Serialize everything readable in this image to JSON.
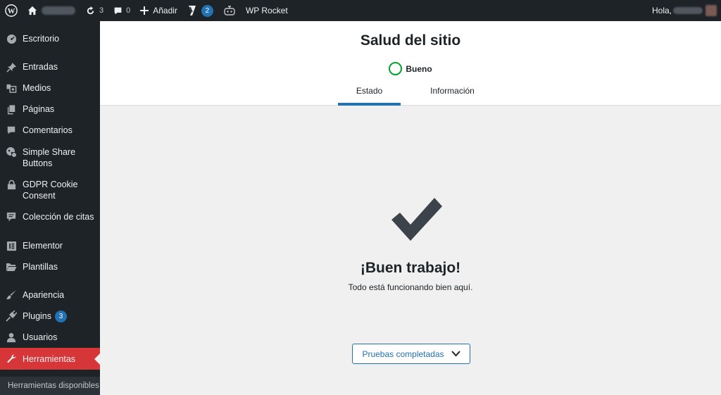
{
  "adminbar": {
    "updates_count": "3",
    "comments_count": "0",
    "add_new_label": "Añadir",
    "yoast_badge": "2",
    "wp_rocket_label": "WP Rocket",
    "greeting": "Hola,"
  },
  "sidebar": {
    "items": [
      {
        "label": "Escritorio",
        "icon": "dashboard-icon"
      },
      {
        "label": "Entradas",
        "icon": "pin-icon"
      },
      {
        "label": "Medios",
        "icon": "media-icon"
      },
      {
        "label": "Páginas",
        "icon": "pages-icon"
      },
      {
        "label": "Comentarios",
        "icon": "comment-icon"
      },
      {
        "label": "Simple Share Buttons",
        "icon": "share-icon"
      },
      {
        "label": "GDPR Cookie Consent",
        "icon": "lock-icon"
      },
      {
        "label": "Colección de citas",
        "icon": "quote-icon"
      },
      {
        "label": "Elementor",
        "icon": "elementor-icon"
      },
      {
        "label": "Plantillas",
        "icon": "folder-icon"
      },
      {
        "label": "Apariencia",
        "icon": "brush-icon"
      },
      {
        "label": "Plugins",
        "icon": "plugin-icon",
        "badge": "3"
      },
      {
        "label": "Usuarios",
        "icon": "user-icon"
      },
      {
        "label": "Herramientas",
        "icon": "wrench-icon",
        "active": true
      }
    ],
    "submenu_label": "Herramientas disponibles"
  },
  "header": {
    "title": "Salud del sitio",
    "status": "Bueno",
    "tabs": [
      {
        "label": "Estado",
        "active": true
      },
      {
        "label": "Información",
        "active": false
      }
    ]
  },
  "main": {
    "heading": "¡Buen trabajo!",
    "message": "Todo está funcionando bien aquí.",
    "tests_button": "Pruebas completadas"
  },
  "colors": {
    "adminbar_bg": "#1d2327",
    "active_menu": "#d63638",
    "accent": "#2271b1",
    "good_status": "#00a32a"
  }
}
